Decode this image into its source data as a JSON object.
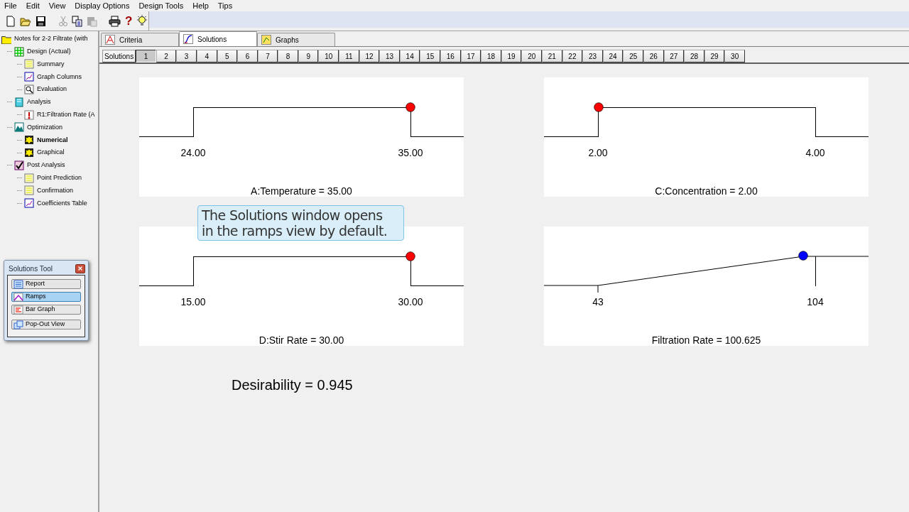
{
  "menu": [
    "File",
    "Edit",
    "View",
    "Display Options",
    "Design Tools",
    "Help",
    "Tips"
  ],
  "toolbar": {
    "help_glyph": "?",
    "paste_disabled": true
  },
  "tree": {
    "label": "Notes for 2-2 Filtrate (with",
    "selected": false,
    "children": [
      {
        "label": "Design (Actual)",
        "selected": false,
        "children": [
          {
            "label": "Summary",
            "selected": false
          },
          {
            "label": "Graph Columns",
            "selected": false
          },
          {
            "label": "Evaluation",
            "selected": false
          }
        ]
      },
      {
        "label": "Analysis",
        "selected": false,
        "children": [
          {
            "label": "R1:Filtration Rate (A",
            "selected": false
          }
        ]
      },
      {
        "label": "Optimization",
        "selected": false,
        "children": [
          {
            "label": "Numerical",
            "selected": true
          },
          {
            "label": "Graphical",
            "selected": false
          }
        ]
      },
      {
        "label": "Post Analysis",
        "selected": false,
        "children": [
          {
            "label": "Point Prediction",
            "selected": false
          },
          {
            "label": "Confirmation",
            "selected": false
          },
          {
            "label": "Coefficients Table",
            "selected": false
          }
        ]
      }
    ]
  },
  "solutions_tool": {
    "title": "Solutions Tool",
    "buttons": [
      {
        "label": "Report",
        "selected": false
      },
      {
        "label": "Ramps",
        "selected": true
      },
      {
        "label": "Bar Graph",
        "selected": false
      },
      {
        "label": "Pop-Out View",
        "selected": false
      }
    ]
  },
  "tabs": [
    {
      "label": "Criteria",
      "selected": false
    },
    {
      "label": "Solutions",
      "selected": true
    },
    {
      "label": "Graphs",
      "selected": false
    }
  ],
  "solutions_bar": {
    "label": "Solutions",
    "items": [
      {
        "label": "1",
        "selected": true
      },
      {
        "label": "2",
        "selected": false
      },
      {
        "label": "3",
        "selected": false
      },
      {
        "label": "4",
        "selected": false
      },
      {
        "label": "5",
        "selected": false
      },
      {
        "label": "6",
        "selected": false
      },
      {
        "label": "7",
        "selected": false
      },
      {
        "label": "8",
        "selected": false
      },
      {
        "label": "9",
        "selected": false
      },
      {
        "label": "10",
        "selected": false
      },
      {
        "label": "11",
        "selected": false
      },
      {
        "label": "12",
        "selected": false
      },
      {
        "label": "13",
        "selected": false
      },
      {
        "label": "14",
        "selected": false
      },
      {
        "label": "15",
        "selected": false
      },
      {
        "label": "16",
        "selected": false
      },
      {
        "label": "17",
        "selected": false
      },
      {
        "label": "18",
        "selected": false
      },
      {
        "label": "19",
        "selected": false
      },
      {
        "label": "20",
        "selected": false
      },
      {
        "label": "21",
        "selected": false
      },
      {
        "label": "22",
        "selected": false
      },
      {
        "label": "23",
        "selected": false
      },
      {
        "label": "24",
        "selected": false
      },
      {
        "label": "25",
        "selected": false
      },
      {
        "label": "26",
        "selected": false
      },
      {
        "label": "27",
        "selected": false
      },
      {
        "label": "28",
        "selected": false
      },
      {
        "label": "29",
        "selected": false
      },
      {
        "label": "30",
        "selected": false
      }
    ]
  },
  "ramps": [
    {
      "kind": "step",
      "low": "24.00",
      "high": "35.00",
      "title": "A:Temperature = 35.00",
      "level": 1,
      "color": "#ff0000"
    },
    {
      "kind": "step",
      "low": "2.00",
      "high": "4.00",
      "title": "C:Concentration = 2.00",
      "level": 0,
      "color": "#ff0000"
    },
    {
      "kind": "step",
      "low": "15.00",
      "high": "30.00",
      "title": "D:Stir Rate = 30.00",
      "level": 1,
      "color": "#ff0000"
    },
    {
      "kind": "slope",
      "low": "43",
      "high": "104",
      "title": "Filtration Rate = 100.625",
      "level": 0.945,
      "color": "#0000ff"
    }
  ],
  "callout": "The Solutions window opens in the ramps view by default.",
  "desirability": "Desirability = 0.945"
}
